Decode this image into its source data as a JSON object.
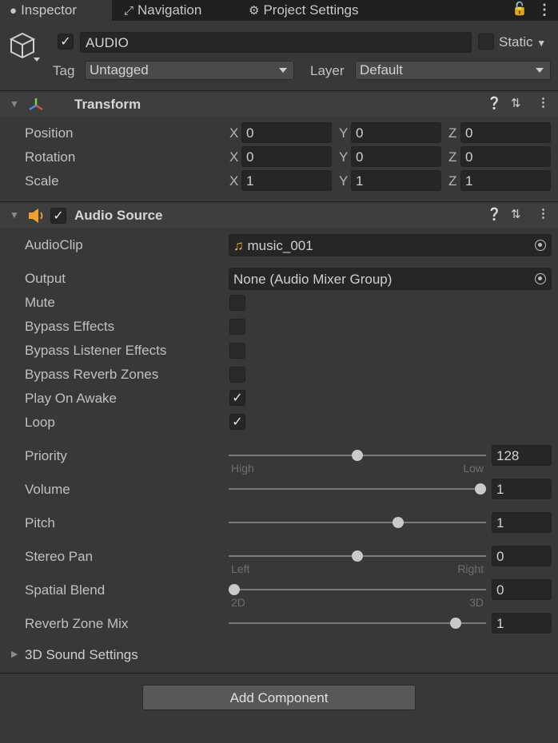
{
  "tabs": [
    {
      "label": "Inspector",
      "icon": "info-icon"
    },
    {
      "label": "Navigation",
      "icon": "navigation-icon"
    },
    {
      "label": "Project Settings",
      "icon": "gear-icon"
    }
  ],
  "header": {
    "object_name": "AUDIO",
    "active_checked": true,
    "static_label": "Static",
    "tag_label": "Tag",
    "tag_value": "Untagged",
    "layer_label": "Layer",
    "layer_value": "Default"
  },
  "transform": {
    "title": "Transform",
    "rows": [
      {
        "label": "Position",
        "x": "0",
        "y": "0",
        "z": "0"
      },
      {
        "label": "Rotation",
        "x": "0",
        "y": "0",
        "z": "0"
      },
      {
        "label": "Scale",
        "x": "1",
        "y": "1",
        "z": "1"
      }
    ],
    "axis_x": "X",
    "axis_y": "Y",
    "axis_z": "Z"
  },
  "audio_source": {
    "title": "Audio Source",
    "enabled": true,
    "audioclip_label": "AudioClip",
    "audioclip_value": "music_001",
    "output_label": "Output",
    "output_value": "None (Audio Mixer Group)",
    "toggles": [
      {
        "label": "Mute",
        "checked": false
      },
      {
        "label": "Bypass Effects",
        "checked": false
      },
      {
        "label": "Bypass Listener Effects",
        "checked": false
      },
      {
        "label": "Bypass Reverb Zones",
        "checked": false
      },
      {
        "label": "Play On Awake",
        "checked": true
      },
      {
        "label": "Loop",
        "checked": true
      }
    ],
    "sliders": [
      {
        "label": "Priority",
        "value": "128",
        "level": 0.5,
        "left": "High",
        "right": "Low"
      },
      {
        "label": "Volume",
        "value": "1",
        "level": 1.0,
        "left": "",
        "right": ""
      },
      {
        "label": "Pitch",
        "value": "1",
        "level": 0.667,
        "left": "",
        "right": ""
      },
      {
        "label": "Stereo Pan",
        "value": "0",
        "level": 0.5,
        "left": "Left",
        "right": "Right"
      },
      {
        "label": "Spatial Blend",
        "value": "0",
        "level": 0.0,
        "left": "2D",
        "right": "3D"
      },
      {
        "label": "Reverb Zone Mix",
        "value": "1",
        "level": 0.9,
        "left": "",
        "right": ""
      }
    ],
    "sound_settings_label": "3D Sound Settings"
  },
  "add_component_label": "Add Component",
  "colors": {
    "background": "#383838",
    "field": "#262626",
    "tabbar": "#1f1f1f",
    "audio_icon": "#f0a030"
  }
}
